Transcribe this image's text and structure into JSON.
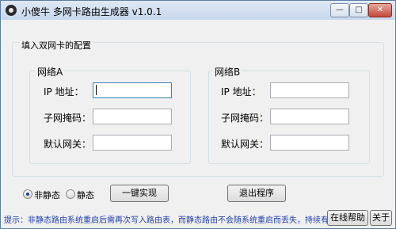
{
  "window": {
    "title": "小傻牛 多网卡路由生成器 v1.0.1"
  },
  "config": {
    "legend": "填入双网卡的配置",
    "network_a": {
      "legend": "网络A",
      "ip_label": "IP  地址：",
      "mask_label": "子网掩码：",
      "gateway_label": "默认网关：",
      "ip_value": "",
      "mask_value": "",
      "gateway_value": ""
    },
    "network_b": {
      "legend": "网络B",
      "ip_label": "IP  地址：",
      "mask_label": "子网掩码：",
      "gateway_label": "默认网关：",
      "ip_value": "",
      "mask_value": "",
      "gateway_value": ""
    }
  },
  "mode": {
    "options": [
      "非静态",
      "静态"
    ],
    "selected": "非静态"
  },
  "actions": {
    "generate": "一键实现",
    "exit": "退出程序",
    "help": "在线帮助",
    "about": "关于"
  },
  "tip": "提示：非静态路由系统重启后需再次写入路由表，而静态路由不会随系统重启而丢失，持续有效",
  "icons": {
    "app": "app-icon",
    "minimize": "minimize-icon",
    "maximize": "maximize-icon",
    "close": "close-icon"
  }
}
